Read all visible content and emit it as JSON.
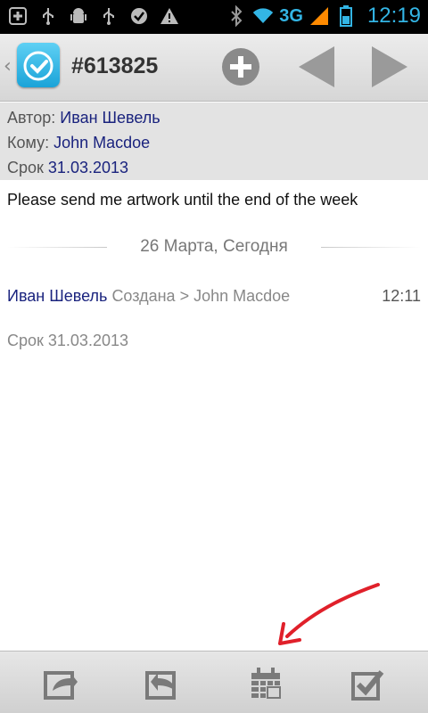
{
  "status_bar": {
    "network": "3G",
    "time": "12:19",
    "left_icons": [
      "add-notification-icon",
      "usb-icon",
      "android-debug-icon",
      "usb-icon",
      "check-icon",
      "warning-icon"
    ],
    "right_icons": [
      "bluetooth-icon",
      "wifi-icon",
      "signal-icon",
      "battery-icon"
    ]
  },
  "header": {
    "back_glyph": "‹",
    "ticket_id": "#613825",
    "buttons": [
      "add-icon",
      "prev-icon",
      "next-icon"
    ]
  },
  "info": {
    "author_label": "Автор:",
    "author_value": "Иван Шевель",
    "to_label": "Кому:",
    "to_value": "John Macdoe",
    "due_label": "Срок",
    "due_value": "31.03.2013"
  },
  "message": "Please send me artwork until the end of the week",
  "date_separator": "26 Марта, Сегодня",
  "log": {
    "author": "Иван Шевель",
    "action": "Создана > John Macdoe",
    "time": "12:11",
    "due_line": "Срок 31.03.2013"
  },
  "bottom_bar": {
    "buttons": [
      "forward-icon",
      "reply-icon",
      "calendar-icon",
      "complete-icon"
    ]
  },
  "colors": {
    "accent_blue": "#33b5e5",
    "link_navy": "#1a237e",
    "annotation_red": "#e0202a"
  }
}
